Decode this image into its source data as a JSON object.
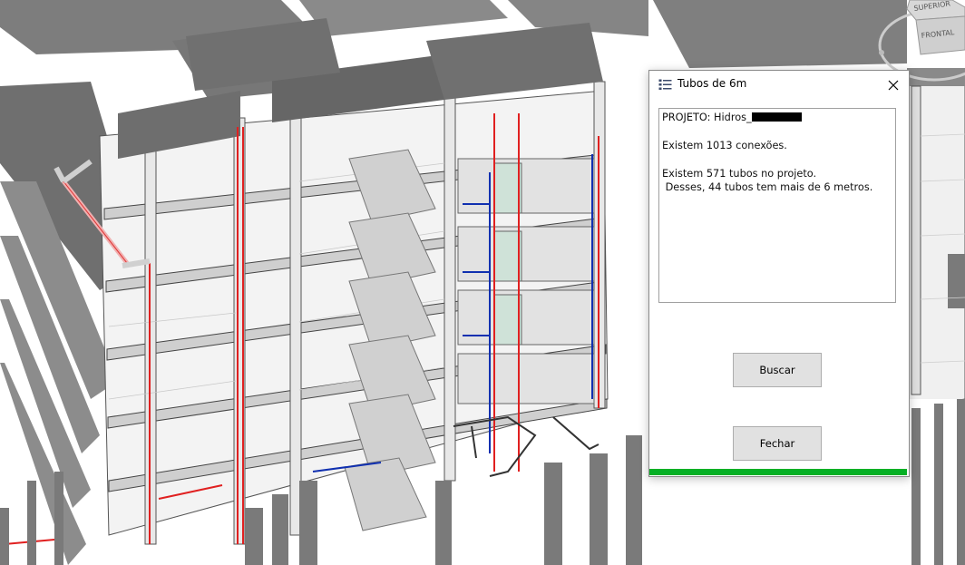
{
  "viewcube": {
    "top_label": "SUPERIOR",
    "front_label": "FRONTAL"
  },
  "dialog": {
    "title": "Tubos de 6m",
    "close_glyph": "✕",
    "output_lines": [
      "PROJETO: Hidros_",
      "",
      "Existem 1013 conexões.",
      "",
      "Existem 571 tubos no projeto.",
      " Desses, 44 tubos tem mais de 6 metros."
    ],
    "buttons": {
      "search": "Buscar",
      "close": "Fechar"
    },
    "progress_fraction": 1.0,
    "colors": {
      "progress": "#06b025"
    }
  }
}
